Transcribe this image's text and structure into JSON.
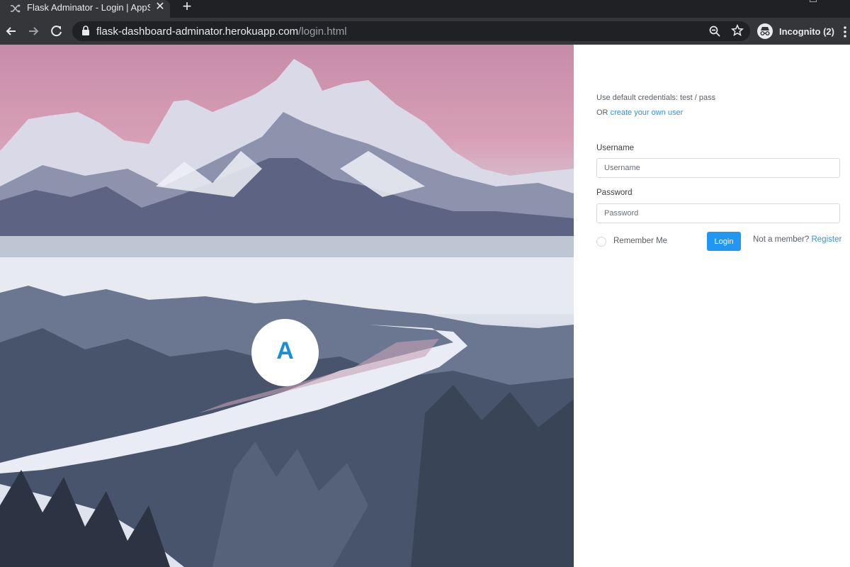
{
  "browser": {
    "tab_title": "Flask Adminator - Login | AppSeed",
    "new_tab_symbol": "+",
    "close_symbol": "✕",
    "url_host": "flask-dashboard-adminator.herokuapp.com",
    "url_path": "/login.html",
    "incognito_label": "Incognito (2)"
  },
  "hero": {
    "logo_letter": "A"
  },
  "login": {
    "hint_line1": "Use default credentials: test / pass",
    "hint_or": "OR",
    "hint_link": "create your own user",
    "username_label": "Username",
    "username_placeholder": "Username",
    "username_value": "",
    "password_label": "Password",
    "password_placeholder": "Password",
    "password_value": "",
    "remember_label": "Remember Me",
    "remember_checked": false,
    "login_button": "Login",
    "member_text": "Not a member?",
    "register_link": "Register"
  },
  "colors": {
    "accent": "#2196f3",
    "link": "#3391d6",
    "chrome_dark": "#202124",
    "chrome_toolbar": "#35363a"
  },
  "icons": [
    "shuffle-icon",
    "close-icon",
    "plus-icon",
    "back-icon",
    "forward-icon",
    "reload-icon",
    "lock-icon",
    "zoom-icon",
    "star-icon",
    "incognito-icon",
    "menu-dots-icon"
  ]
}
